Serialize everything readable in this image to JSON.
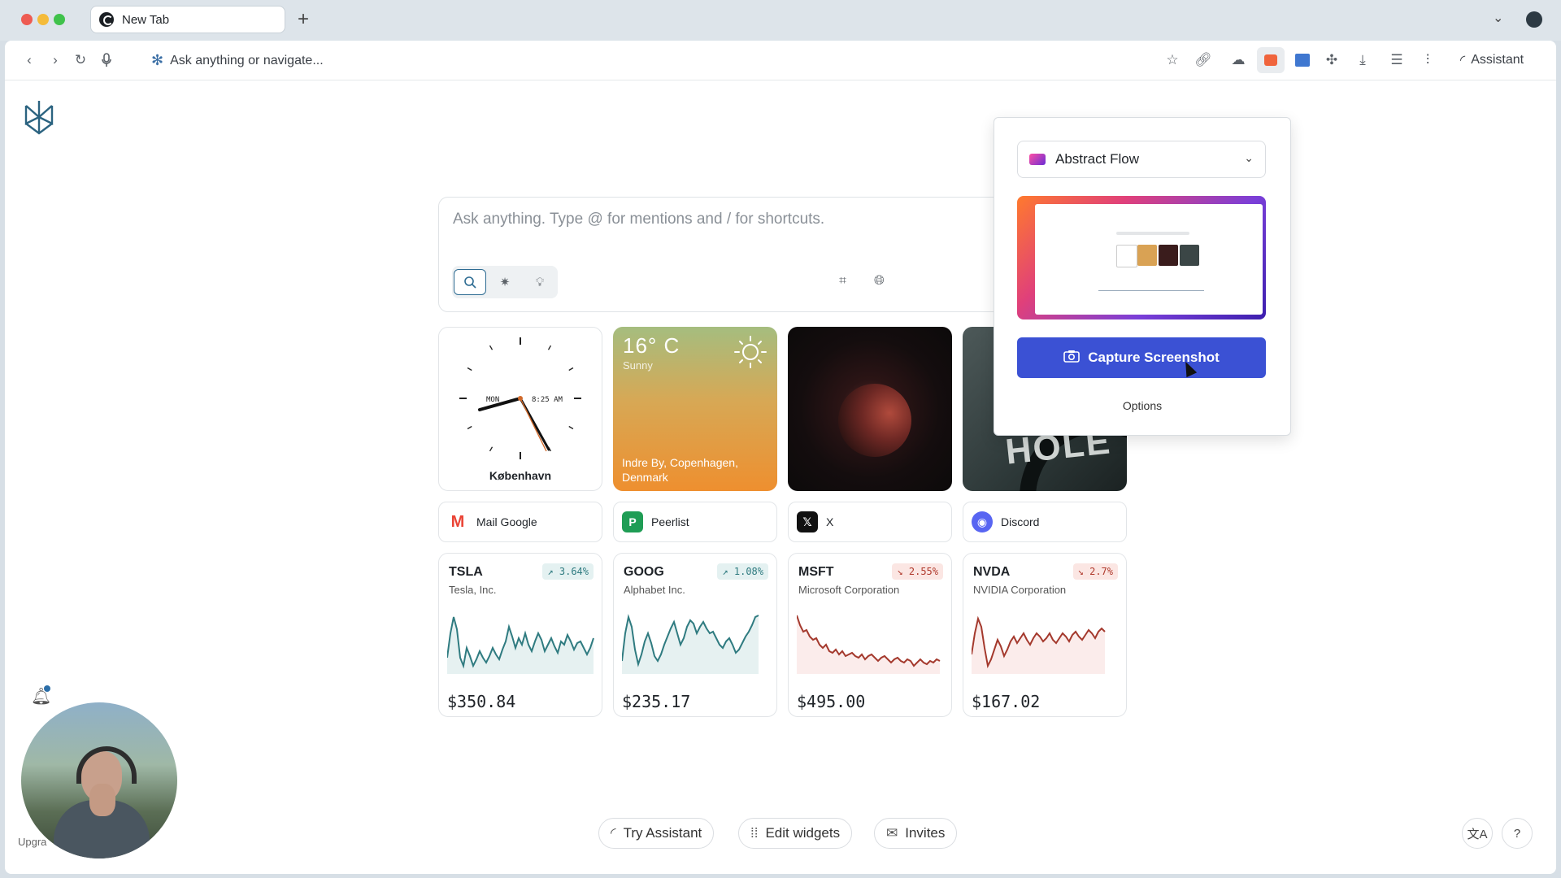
{
  "browser": {
    "tab_title": "New Tab",
    "address_placeholder": "Ask anything or navigate...",
    "assistant_label": "Assistant"
  },
  "search": {
    "placeholder": "Ask anything. Type @ for mentions and / for shortcuts."
  },
  "widgets": {
    "clock": {
      "city": "København",
      "day": "MON",
      "time": "8:25 AM"
    },
    "weather": {
      "temp": "16° C",
      "condition": "Sunny",
      "location": "Indre By, Copenhagen, Denmark"
    },
    "photo_text": "WO M HOLE"
  },
  "links": [
    {
      "label": "Mail Google",
      "icon": "gmail-icon",
      "color": "#ea4335"
    },
    {
      "label": "Peerlist",
      "icon": "peerlist-icon",
      "color": "#1f9d55"
    },
    {
      "label": "X",
      "icon": "x-icon",
      "color": "#111111"
    },
    {
      "label": "Discord",
      "icon": "discord-icon",
      "color": "#5865f2"
    }
  ],
  "stocks": [
    {
      "symbol": "TSLA",
      "company": "Tesla, Inc.",
      "change": "↗ 3.64%",
      "direction": "up",
      "price": "$350.84"
    },
    {
      "symbol": "GOOG",
      "company": "Alphabet Inc.",
      "change": "↗ 1.08%",
      "direction": "up",
      "price": "$235.17"
    },
    {
      "symbol": "MSFT",
      "company": "Microsoft Corporation",
      "change": "↘ 2.55%",
      "direction": "down",
      "price": "$495.00"
    },
    {
      "symbol": "NVDA",
      "company": "NVIDIA Corporation",
      "change": "↘ 2.7%",
      "direction": "down",
      "price": "$167.02"
    }
  ],
  "popup": {
    "theme": "Abstract Flow",
    "capture_label": "Capture Screenshot",
    "options_label": "Options"
  },
  "bottom": {
    "try_assistant": "Try Assistant",
    "edit_widgets": "Edit widgets",
    "invites": "Invites",
    "upgrade": "Upgra"
  },
  "colors": {
    "accent": "#3b51d4",
    "up": "#2f7b80",
    "down": "#b0392c"
  }
}
